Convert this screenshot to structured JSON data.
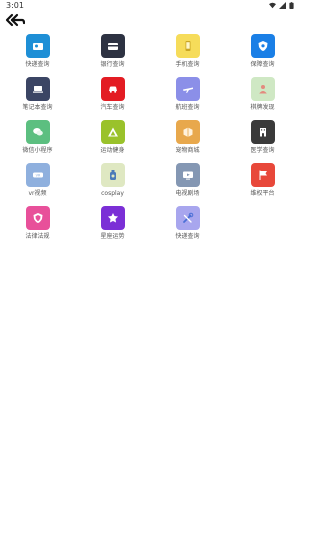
{
  "status_bar": {
    "time": "3:01"
  },
  "items": [
    {
      "label": "快递查询",
      "color": "#1e8fd6",
      "icon": "person-card-icon"
    },
    {
      "label": "银行查询",
      "color": "#2d3242",
      "icon": "bank-card-icon"
    },
    {
      "label": "手机查询",
      "color": "#f6dc5a",
      "icon": "phone-icon"
    },
    {
      "label": "保障查询",
      "color": "#1a7fe6",
      "icon": "shield-icon"
    },
    {
      "label": "笔记本查询",
      "color": "#3b4564",
      "icon": "laptop-icon"
    },
    {
      "label": "汽车查询",
      "color": "#e31c23",
      "icon": "car-icon"
    },
    {
      "label": "航班查询",
      "color": "#8b8fe8",
      "icon": "plane-icon"
    },
    {
      "label": "棋牌发现",
      "color": "#cfe8c4",
      "icon": "person-icon"
    },
    {
      "label": "微信小程序",
      "color": "#5cbf80",
      "icon": "wechat-icon"
    },
    {
      "label": "运动健身",
      "color": "#9ac22b",
      "icon": "triangle-icon"
    },
    {
      "label": "宠物商城",
      "color": "#e8a84c",
      "icon": "box-icon"
    },
    {
      "label": "医学查询",
      "color": "#3a3a3a",
      "icon": "building-icon"
    },
    {
      "label": "vr视频",
      "color": "#8fb0de",
      "icon": "vr-icon"
    },
    {
      "label": "cosplay",
      "color": "#dfe8c2",
      "icon": "bottle-icon"
    },
    {
      "label": "电视剧场",
      "color": "#8497b3",
      "icon": "tv-icon"
    },
    {
      "label": "维权平台",
      "color": "#e8483a",
      "icon": "flag-icon"
    },
    {
      "label": "法律法规",
      "color": "#e8509a",
      "icon": "law-shield-icon"
    },
    {
      "label": "星座运势",
      "color": "#7b2fd6",
      "icon": "star-icon"
    },
    {
      "label": "快递查询",
      "color": "#a8a6ee",
      "icon": "tools-icon"
    }
  ]
}
